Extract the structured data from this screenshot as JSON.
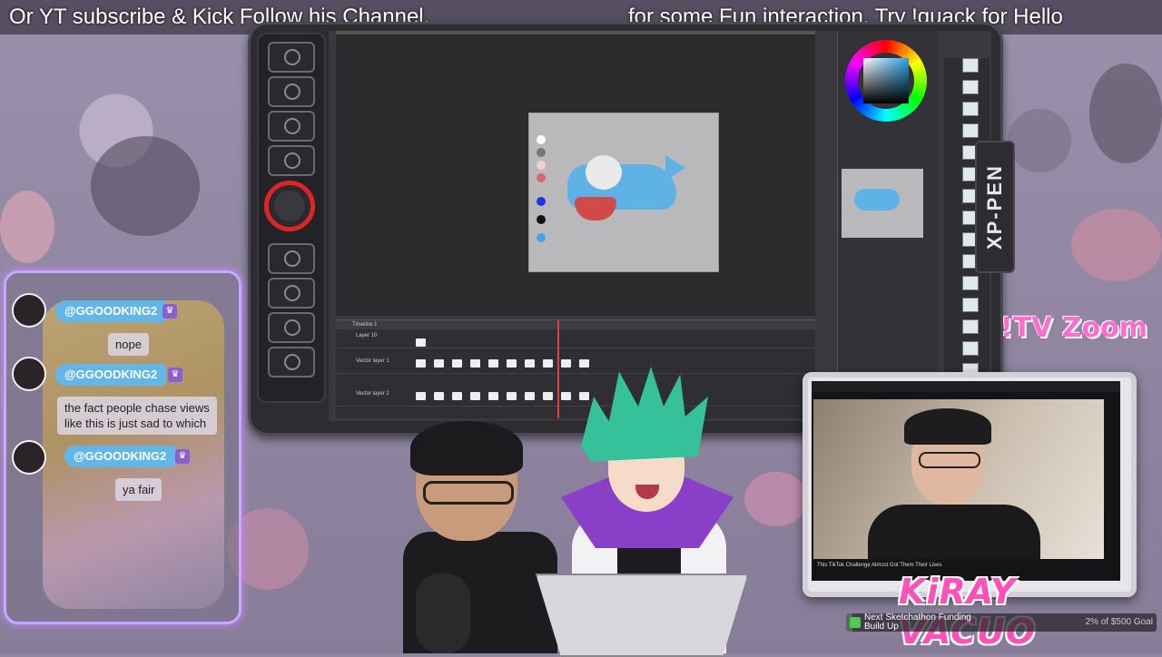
{
  "ticker": {
    "left_text": "Or  YT subscribe & Kick Follow his Channel.",
    "right_text": "for some Fun interaction, Try !quack for Hello"
  },
  "tablet": {
    "brand": "XP-PEN",
    "express_keys": 8,
    "dial_color": "#e02424"
  },
  "software": {
    "timeline_label": "Timeline 1",
    "layers": [
      "Layer 10",
      "Vector layer 1",
      "Vector layer 2"
    ],
    "playhead_frame": "10"
  },
  "overlay": {
    "tv_zoom": "!TV Zoom",
    "streamer_name": "KiRAY VACUO"
  },
  "chat": {
    "messages": [
      {
        "user": "@GGOODKING2",
        "text": "nope"
      },
      {
        "user": "@GGOODKING2",
        "text": "the fact people chase views like this is just sad to which"
      },
      {
        "user": "@GGOODKING2",
        "text": "ya fair"
      }
    ],
    "username_color": "#62b6e8",
    "badge_icon": "crown-icon"
  },
  "goal": {
    "label": "Next Sketchathon Funding Build Up",
    "progress_text": "2% of $500 Goal",
    "progress": 0.02
  },
  "monitor": {
    "caption": "This TikTok Challenge Almost Got Them Their Lives"
  }
}
